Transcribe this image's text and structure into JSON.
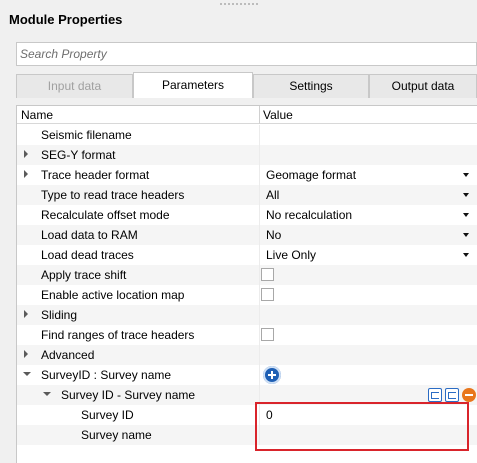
{
  "panel": {
    "title": "Module Properties"
  },
  "search": {
    "placeholder": "Search Property"
  },
  "tabs": [
    {
      "label": "Input data",
      "state": "disabled"
    },
    {
      "label": "Parameters",
      "state": "active"
    },
    {
      "label": "Settings",
      "state": "normal"
    },
    {
      "label": "Output data",
      "state": "normal"
    }
  ],
  "grid": {
    "columns": {
      "name": "Name",
      "value": "Value"
    },
    "rows": [
      {
        "label": "Seismic filename",
        "value": ""
      },
      {
        "label": "SEG-Y format",
        "value": ""
      },
      {
        "label": "Trace header format",
        "value": "Geomage format"
      },
      {
        "label": "Type to read trace headers",
        "value": "All"
      },
      {
        "label": "Recalculate offset mode",
        "value": "No recalculation"
      },
      {
        "label": "Load data to RAM",
        "value": "No"
      },
      {
        "label": "Load dead traces",
        "value": "Live Only"
      },
      {
        "label": "Apply trace shift",
        "value": ""
      },
      {
        "label": "Enable active location map",
        "value": ""
      },
      {
        "label": "Sliding",
        "value": ""
      },
      {
        "label": "Find ranges of trace headers",
        "value": ""
      },
      {
        "label": "Advanced",
        "value": ""
      },
      {
        "label": "SurveyID : Survey name",
        "value": ""
      },
      {
        "label": "Survey ID - Survey name",
        "value": ""
      },
      {
        "label": "Survey ID",
        "value": "0"
      },
      {
        "label": "Survey name",
        "value": ""
      }
    ]
  },
  "icons": {
    "add": "plus-circle-icon",
    "dropdown": "chevron-down-icon",
    "expand": "triangle-right-icon",
    "collapse": "triangle-down-icon",
    "copy": "copy-icon",
    "paste": "paste-icon",
    "remove": "minus-circle-icon"
  },
  "colors": {
    "highlight": "#d9242b",
    "accent_blue": "#1e5fb4",
    "remove_orange": "#e8761c"
  }
}
